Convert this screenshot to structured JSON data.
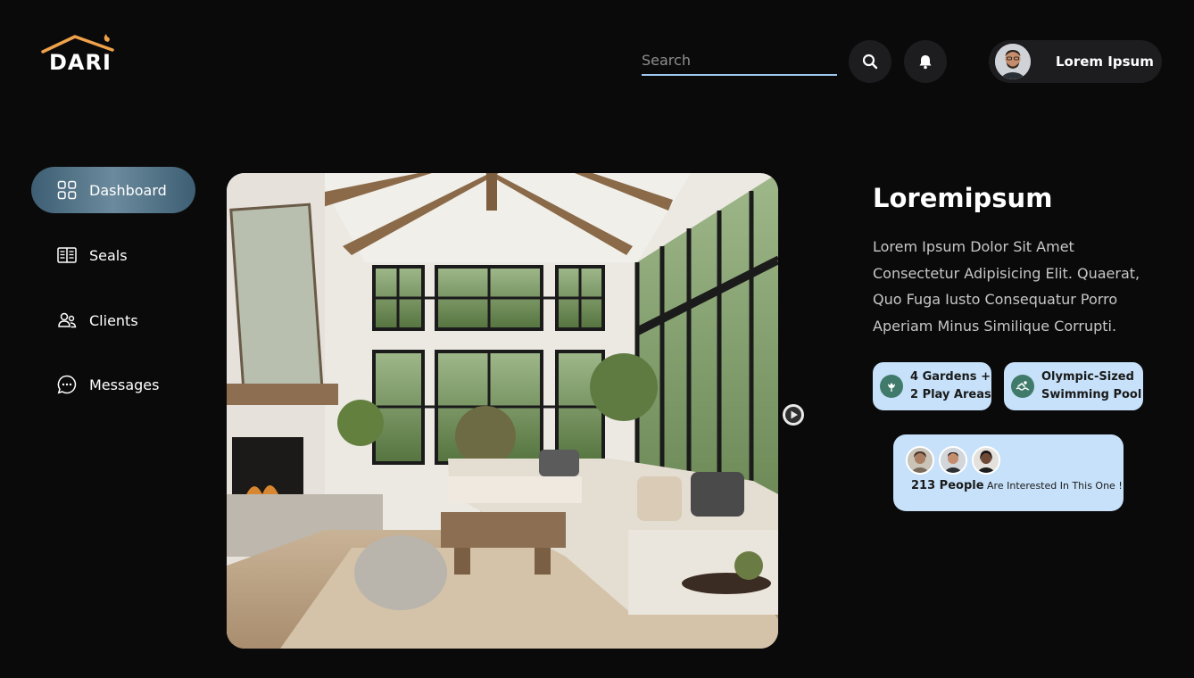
{
  "brand": {
    "name": "DARI"
  },
  "header": {
    "search_placeholder": "Search",
    "user_name": "Lorem Ipsum"
  },
  "sidebar": {
    "items": [
      {
        "label": "Dashboard",
        "icon": "grid-icon",
        "active": true
      },
      {
        "label": "Seals",
        "icon": "book-icon",
        "active": false
      },
      {
        "label": "Clients",
        "icon": "users-icon",
        "active": false
      },
      {
        "label": "Messages",
        "icon": "chat-icon",
        "active": false
      }
    ]
  },
  "property": {
    "title": "Loremipsum",
    "description": "Lorem Ipsum Dolor Sit Amet Consectetur Adipisicing Elit. Quaerat, Quo Fuga Iusto Consequatur Porro Aperiam Minus Similique Corrupti.",
    "features": [
      {
        "line1": "4 Gardens +",
        "line2": "2 Play Areas",
        "icon": "flower-icon"
      },
      {
        "line1": "Olympic-Sized",
        "line2": "Swimming Pool",
        "icon": "swimmer-icon"
      }
    ],
    "interest": {
      "count": "213 People",
      "text": "Are Interested In This One !"
    }
  },
  "colors": {
    "background": "#0b0a0b",
    "accent": "#c6e1f9",
    "active_nav": "#4f7286",
    "logo_orange": "#f0a24b"
  }
}
